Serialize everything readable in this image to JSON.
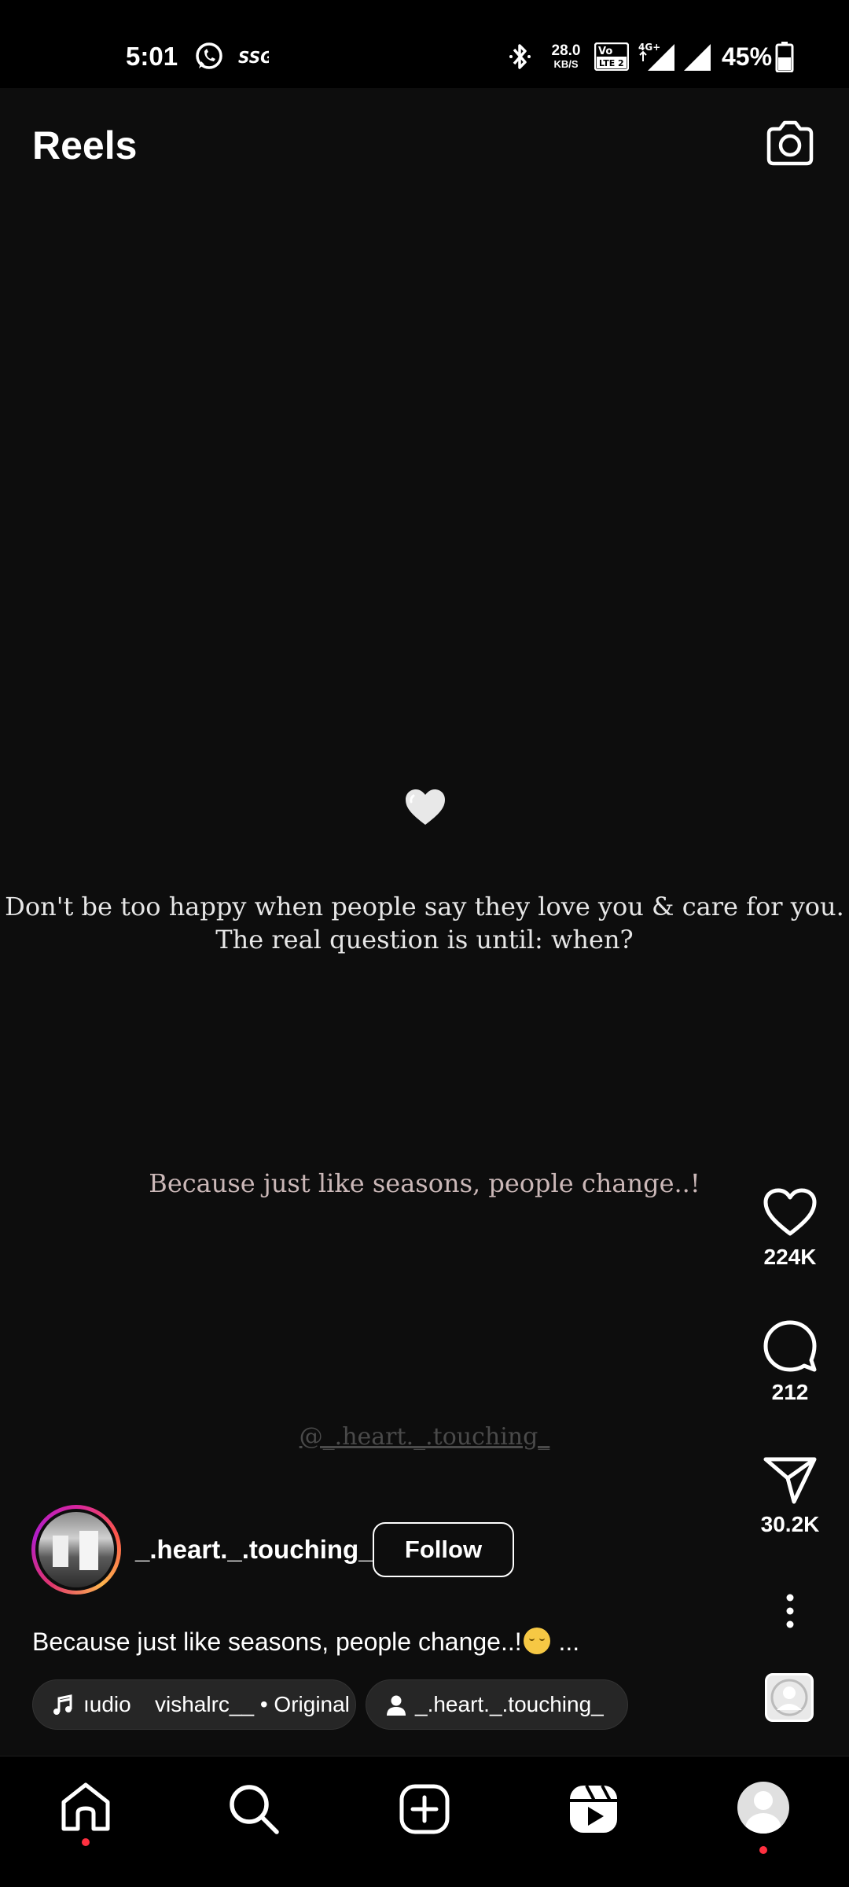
{
  "status_bar": {
    "time": "5:01",
    "network_speed_value": "28.0",
    "network_speed_unit": "KB/S",
    "volte_badge": "Vo LTE 2",
    "network_type": "4G+",
    "battery_percent": "45%",
    "icons": [
      "whatsapp-icon",
      "ssg-icon",
      "bluetooth-icon",
      "volte-icon",
      "signal-icon",
      "signal-icon",
      "battery-icon"
    ]
  },
  "header": {
    "title": "Reels",
    "camera_icon": "camera-icon"
  },
  "video": {
    "heart_emoji": "white-heart-icon",
    "quote_line_1": "Don't be too happy when people say they love you & care for you.",
    "quote_line_2": "The real question is until: when?",
    "quote_secondary": "Because just like seasons, people change..!",
    "watermark": "@_.heart._.touching_"
  },
  "actions": {
    "likes": "224K",
    "comments": "212",
    "shares": "30.2K"
  },
  "post": {
    "author": "_.heart._.touching_",
    "follow_label": "Follow",
    "caption_text": "Because just like seasons, people change..!",
    "caption_more": "...",
    "audio_label": "ıudio",
    "audio_credit": "vishalrc__ • Original",
    "tagged_user": "_.heart._.touching_"
  },
  "nav": {
    "items": [
      "home-icon",
      "search-icon",
      "create-icon",
      "reels-icon",
      "profile-icon"
    ]
  },
  "colors": {
    "background": "#0d0d0d",
    "notification_dot": "#ff3040",
    "chip_bg": "#262626"
  }
}
